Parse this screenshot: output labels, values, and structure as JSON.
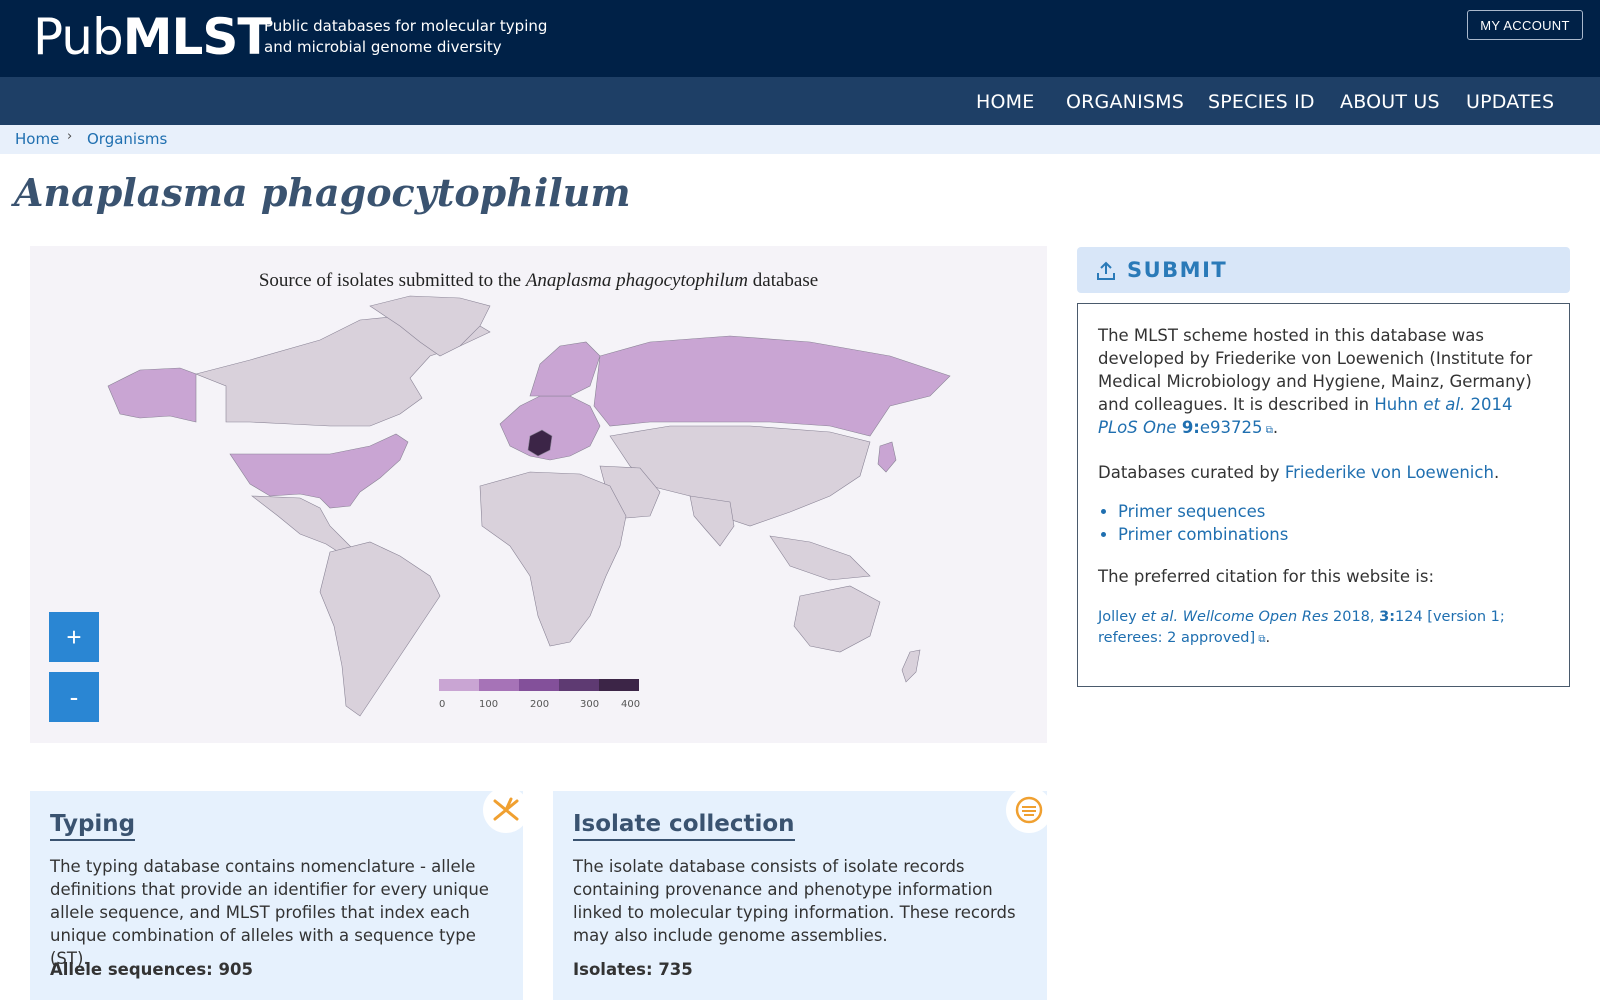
{
  "header": {
    "logo_thin": "Pub",
    "logo_bold": "MLST",
    "tagline_line1": "Public databases for molecular typing",
    "tagline_line2": "and microbial genome diversity",
    "account_label": "MY ACCOUNT"
  },
  "nav": {
    "items": [
      "HOME",
      "ORGANISMS",
      "SPECIES ID",
      "ABOUT US",
      "UPDATES"
    ]
  },
  "breadcrumb": {
    "home": "Home",
    "organisms": "Organisms"
  },
  "page": {
    "title": "Anaplasma phagocytophilum"
  },
  "map": {
    "title_prefix": "Source of isolates submitted to the ",
    "title_species": "Anaplasma phagocytophilum",
    "title_suffix": " database",
    "zoom_in": "+",
    "zoom_out": "-",
    "legend_ticks": [
      "0",
      "100",
      "200",
      "300",
      "400"
    ],
    "legend_colors": [
      "#c9a5d3",
      "#a673b7",
      "#83509a",
      "#5e3a72",
      "#3c2547"
    ],
    "base_color": "#d9d1db",
    "highlight_color": "#c9a5d3",
    "max_color": "#3c2547"
  },
  "submit": {
    "label": "SUBMIT"
  },
  "info": {
    "p1": "The MLST scheme hosted in this database was developed by Friederike von Loewenich (Institute for Medical Microbiology and Hygiene, Mainz, Germany) and colleagues. It is described in ",
    "ref_author": "Huhn",
    "ref_etal": "et al.",
    "ref_year": "2014",
    "ref_journal": "PLoS One",
    "ref_volume": "9:",
    "ref_page": "e93725",
    "curated_prefix": "Databases curated by ",
    "curator": "Friederike von Loewenich",
    "links": [
      "Primer sequences",
      "Primer combinations"
    ],
    "citation_intro": "The preferred citation for this website is:",
    "cite_author": "Jolley",
    "cite_etal": "et al.",
    "cite_journal": "Wellcome Open Res",
    "cite_year": "2018,",
    "cite_volume": "3:",
    "cite_rest": "124 [version 1; referees: 2 approved]"
  },
  "cards": {
    "typing": {
      "title": "Typing",
      "text": "The typing database contains nomenclature - allele definitions that provide an identifier for every unique allele sequence, and MLST profiles that index each unique combination of alleles with a sequence type (ST).",
      "stat": "Allele sequences: 905"
    },
    "isolates": {
      "title": "Isolate collection",
      "text": "The isolate database consists of isolate records containing provenance and phenotype information linked to molecular typing information. These records may also include genome assemblies.",
      "stat": "Isolates: 735"
    }
  }
}
